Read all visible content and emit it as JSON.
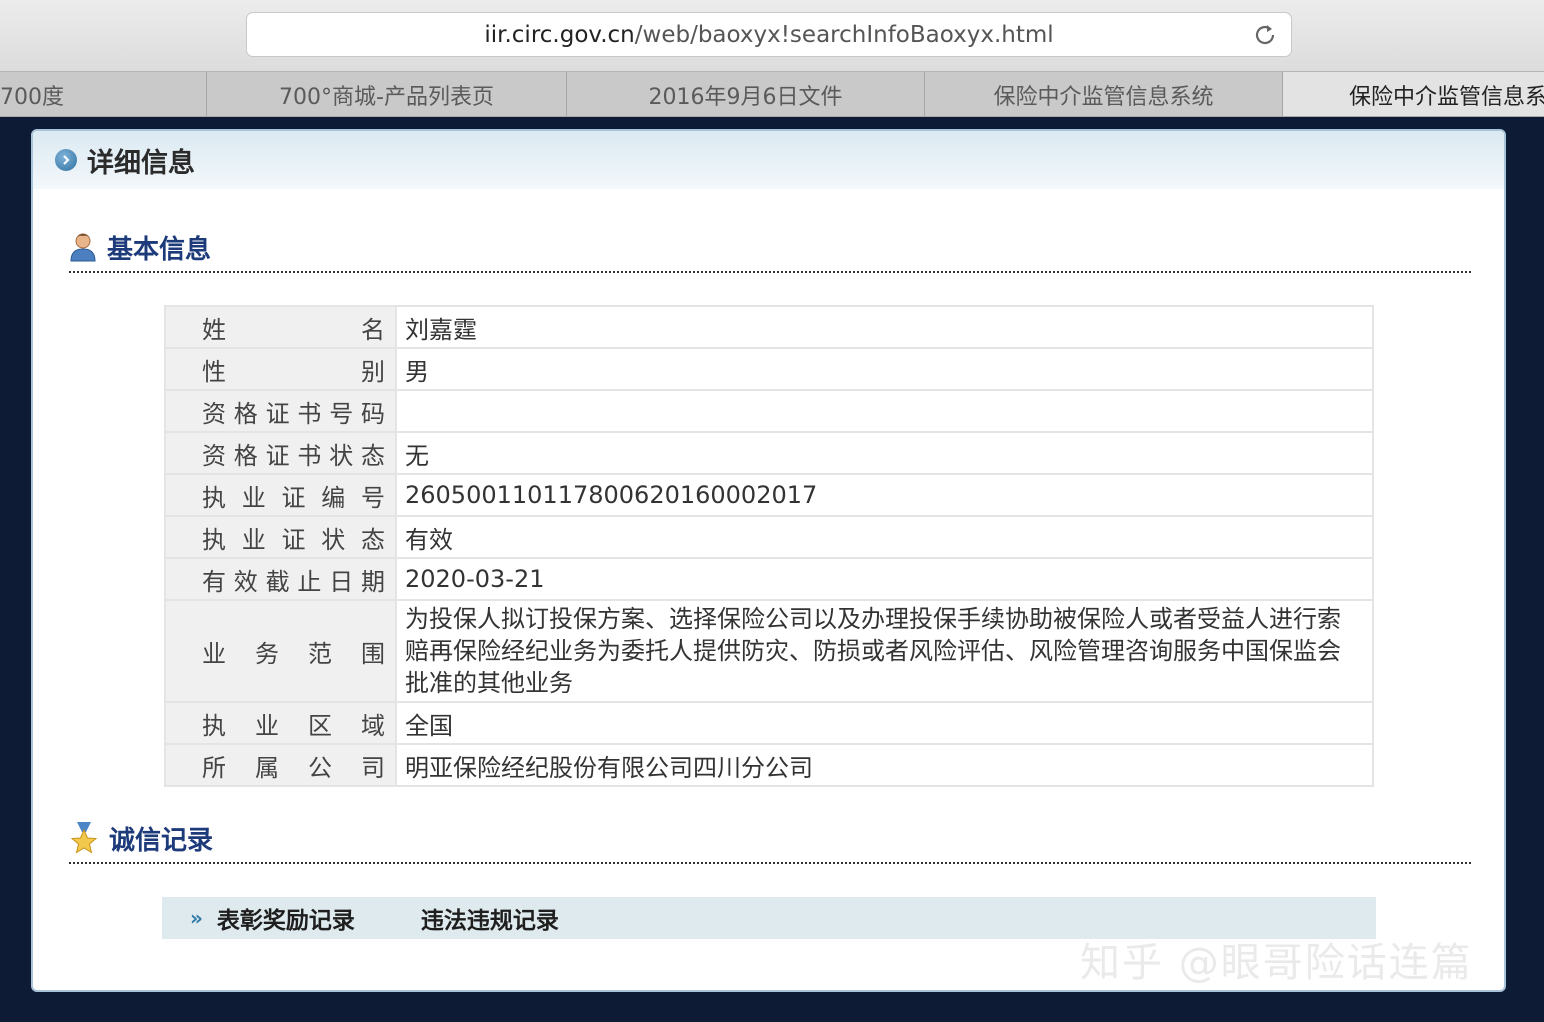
{
  "browser": {
    "url_host": "iir.circ.gov.cn",
    "url_path": "/web/baoxyx!searchInfoBaoxyx.html",
    "tabs": [
      {
        "label": "700度"
      },
      {
        "label": "700°商城-产品列表页"
      },
      {
        "label": "2016年9月6日文件"
      },
      {
        "label": "保险中介监管信息系统"
      },
      {
        "label": "保险中介监管信息系"
      }
    ]
  },
  "panel": {
    "title": "详细信息",
    "basic_section": "基本信息",
    "fields": [
      {
        "label": "姓名",
        "value": "刘嘉霆"
      },
      {
        "label": "性别",
        "value": "男"
      },
      {
        "label": "资格证书号码",
        "value": ""
      },
      {
        "label": "资格证书状态",
        "value": "无"
      },
      {
        "label": "执业证编号",
        "value": "260500110117800620160002017"
      },
      {
        "label": "执业证状态",
        "value": "有效"
      },
      {
        "label": "有效截止日期",
        "value": "2020-03-21"
      },
      {
        "label": "业务范围",
        "value": "为投保人拟订投保方案、选择保险公司以及办理投保手续协助被保险人或者受益人进行索赔再保险经纪业务为委托人提供防灾、防损或者风险评估、风险管理咨询服务中国保监会批准的其他业务"
      },
      {
        "label": "执业区域",
        "value": "全国"
      },
      {
        "label": "所属公司",
        "value": "明亚保险经纪股份有限公司四川分公司"
      }
    ],
    "credit_section": "诚信记录",
    "records": {
      "arrows": "»",
      "reward": "表彰奖励记录",
      "violation": "违法违规记录"
    }
  },
  "watermark": "知乎 @眼哥险话连篇"
}
